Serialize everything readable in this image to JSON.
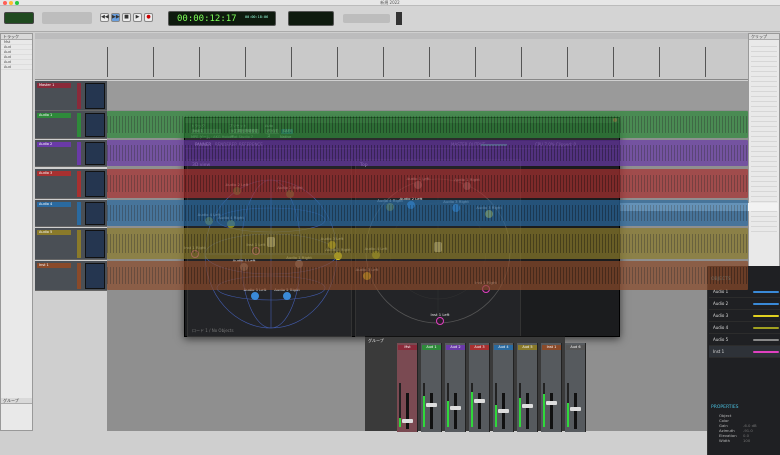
{
  "window_title": "新規 2022",
  "transport": {
    "main_counter": "00:00:12:17",
    "sub_counter": "00:00:18:06",
    "btn_rewind": "◀◀",
    "btn_ff": "▶▶",
    "btn_stop": "■",
    "btn_play": "▶",
    "btn_record": "●"
  },
  "left_pane": {
    "tracks_header": "トラック",
    "groups_header": "グループ",
    "items": [
      "Mst",
      "Aud",
      "Aud",
      "Aud",
      "Aud",
      "Aud"
    ]
  },
  "right_pane": {
    "header": "クリップ"
  },
  "tracks": [
    {
      "name": "Master 1",
      "color": "#8a2a3a"
    },
    {
      "name": "Audio 1",
      "color": "#2e8a3a"
    },
    {
      "name": "Audio 2",
      "color": "#6a3aa8"
    },
    {
      "name": "Audio 3",
      "color": "#a83030"
    },
    {
      "name": "Audio 4",
      "color": "#2a6aa0"
    },
    {
      "name": "Audio 5",
      "color": "#8a7a2a"
    },
    {
      "name": "Inst 1",
      "color": "#8a4a2a"
    }
  ],
  "plugin": {
    "header": {
      "track_label": "トラック",
      "preset_label": "プリセット",
      "auto_label": "Auto",
      "track_value": "Inst 1",
      "preset_value": "<工場出荷時設定>",
      "bypass": "バイパス",
      "compare": "比較",
      "safe": "SAFE",
      "native": "Native",
      "plugin_name": "MPE ゲーム · AKG Holobeat Studio 7"
    },
    "tabs": [
      "PANNER",
      "RENDERER",
      "REFERENCE"
    ],
    "master_output": "MASTER OUTPUT",
    "sample_rate": "CPU 7.0%  Clipped: 0",
    "left_view": "3D view",
    "right_view": "Top",
    "objects_title": "OBJECTS",
    "objects": [
      {
        "name": "Audio 1",
        "color": "#3a8ad8"
      },
      {
        "name": "Audio 2",
        "color": "#3a8ad8"
      },
      {
        "name": "Audio 3",
        "color": "#e0d020"
      },
      {
        "name": "Audio 4",
        "color": "#a0a020"
      },
      {
        "name": "Audio 5",
        "color": "#888888"
      },
      {
        "name": "Inst 1",
        "color": "#e040c0"
      }
    ],
    "properties_title": "PROPERTIES",
    "properties": [
      {
        "label": "Object",
        "value": ""
      },
      {
        "label": "Color",
        "value": ""
      },
      {
        "label": "Gain",
        "value": "-6.0 dB"
      },
      {
        "label": "Azimuth",
        "value": "-91.0"
      },
      {
        "label": "Elevation",
        "value": "0.0"
      },
      {
        "label": "Width",
        "value": "100"
      }
    ],
    "footer_text": "ロード 1 / No Objects",
    "left_objects": [
      {
        "label": "Audio 2 Left",
        "color": "#2e8a3a"
      },
      {
        "label": "Audio 2 Right",
        "color": "#2e8a3a"
      },
      {
        "label": "Audio 4 Left",
        "color": "#8a8a20"
      },
      {
        "label": "Audio 4 Right",
        "color": "#8a8a20"
      },
      {
        "label": "Inst 1 Right",
        "color": "#e040c0"
      },
      {
        "label": "Inst 1 Left",
        "color": "#e040c0"
      },
      {
        "label": "Audio 1 Left",
        "color": "#777777"
      },
      {
        "label": "Audio 1 Right",
        "color": "#777777"
      },
      {
        "label": "Audio 3 Left",
        "color": "#c0b020"
      },
      {
        "label": "Audio 3 Right",
        "color": "#e0d020"
      },
      {
        "label": "Audio 5 Left",
        "color": "#3a8ad8"
      },
      {
        "label": "Audio 5 Right",
        "color": "#3a8ad8"
      }
    ],
    "right_objects": [
      {
        "label": "Audio 1 Left",
        "color": "#777777"
      },
      {
        "label": "Audio 1 Right",
        "color": "#777777"
      },
      {
        "label": "Audio 2 Left",
        "color": "#3a8ad8"
      },
      {
        "label": "Audio 3 Right",
        "color": "#3a8ad8"
      },
      {
        "label": "Audio 3 Right",
        "color": "#e0d020"
      },
      {
        "label": "Audio 4 Right",
        "color": "#8a8a20"
      },
      {
        "label": "Inst 1 Right",
        "color": "#e040c0"
      },
      {
        "label": "Audio 4 Left",
        "color": "#8a8a20"
      },
      {
        "label": "Audio 3 Left",
        "color": "#e0d020"
      },
      {
        "label": "Inst 1 Left",
        "color": "#e040c0"
      }
    ]
  },
  "mixer": {
    "group_label": "グループ",
    "strips": [
      {
        "name": "Mst",
        "color": "#8a2a3a",
        "level": 0.2
      },
      {
        "name": "Aud 1",
        "color": "#2e8a3a",
        "level": 0.7
      },
      {
        "name": "Aud 2",
        "color": "#6a3aa8",
        "level": 0.6
      },
      {
        "name": "Aud 3",
        "color": "#a83030",
        "level": 0.8
      },
      {
        "name": "Aud 4",
        "color": "#2a6aa0",
        "level": 0.5
      },
      {
        "name": "Aud 5",
        "color": "#8a7a2a",
        "level": 0.65
      },
      {
        "name": "Inst 1",
        "color": "#8a4a2a",
        "level": 0.75
      },
      {
        "name": "Aud 6",
        "color": "#555555",
        "level": 0.55
      }
    ]
  }
}
